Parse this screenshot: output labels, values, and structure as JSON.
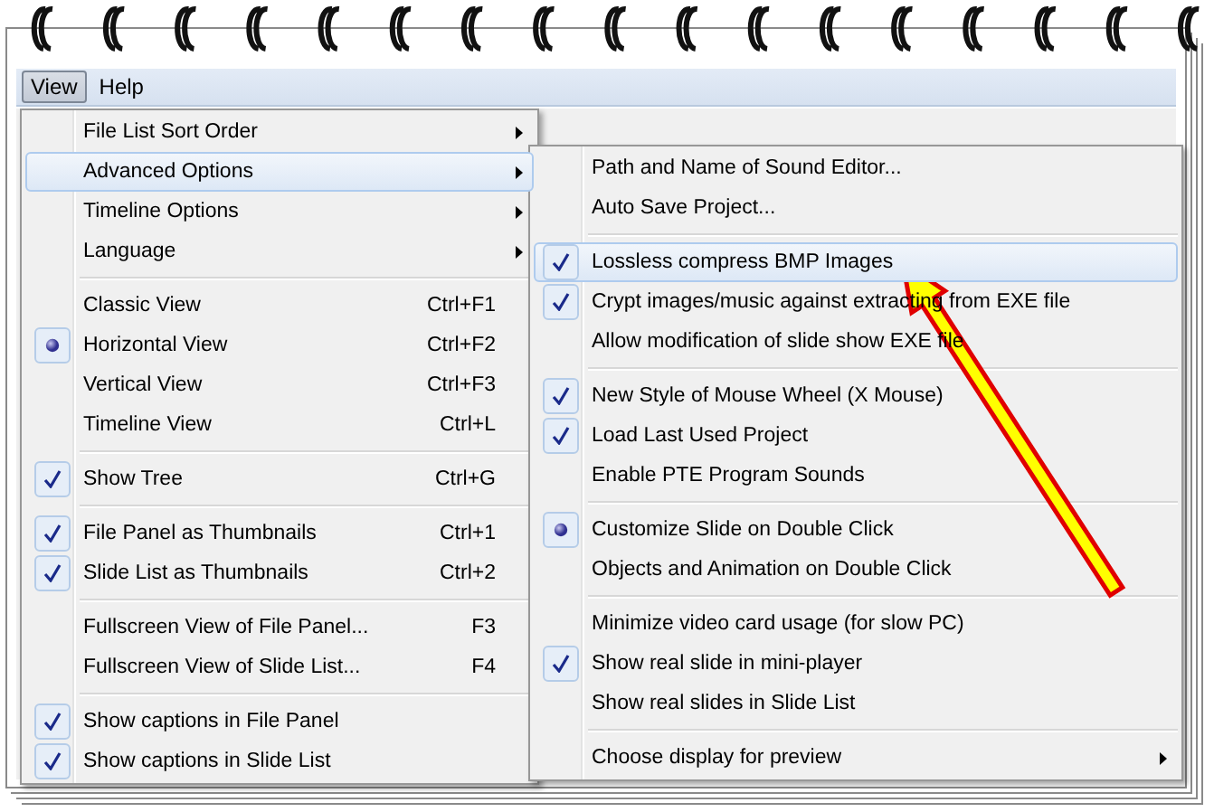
{
  "menubar": [
    {
      "label": "View",
      "selected": true
    },
    {
      "label": "Help",
      "selected": false
    }
  ],
  "view_menu": [
    {
      "kind": "item",
      "label": "File List Sort Order",
      "submenu": true,
      "checked": false,
      "selected": false
    },
    {
      "kind": "item",
      "label": "Advanced Options",
      "submenu": true,
      "checked": false,
      "selected": true
    },
    {
      "kind": "item",
      "label": "Timeline Options",
      "submenu": true,
      "checked": false,
      "selected": false
    },
    {
      "kind": "item",
      "label": "Language",
      "submenu": true,
      "checked": false,
      "selected": false
    },
    {
      "kind": "separator"
    },
    {
      "kind": "item",
      "label": "Classic View",
      "shortcut": "Ctrl+F1",
      "checked": false,
      "selected": false
    },
    {
      "kind": "item",
      "label": "Horizontal View",
      "shortcut": "Ctrl+F2",
      "checked": true,
      "radio": true,
      "selected": false
    },
    {
      "kind": "item",
      "label": "Vertical View",
      "shortcut": "Ctrl+F3",
      "checked": false,
      "selected": false
    },
    {
      "kind": "item",
      "label": "Timeline View",
      "shortcut": "Ctrl+L",
      "checked": false,
      "selected": false
    },
    {
      "kind": "separator"
    },
    {
      "kind": "item",
      "label": "Show Tree",
      "shortcut": "Ctrl+G",
      "checked": true,
      "selected": false
    },
    {
      "kind": "separator"
    },
    {
      "kind": "item",
      "label": "File Panel as Thumbnails",
      "shortcut": "Ctrl+1",
      "checked": true,
      "selected": false
    },
    {
      "kind": "item",
      "label": "Slide List as Thumbnails",
      "shortcut": "Ctrl+2",
      "checked": true,
      "selected": false
    },
    {
      "kind": "separator"
    },
    {
      "kind": "item",
      "label": "Fullscreen View of File Panel...",
      "shortcut": "F3",
      "checked": false,
      "selected": false
    },
    {
      "kind": "item",
      "label": "Fullscreen View of Slide List...",
      "shortcut": "F4",
      "checked": false,
      "selected": false
    },
    {
      "kind": "separator"
    },
    {
      "kind": "item",
      "label": "Show captions in File Panel",
      "checked": true,
      "selected": false
    },
    {
      "kind": "item",
      "label": "Show captions in Slide List",
      "checked": true,
      "selected": false
    }
  ],
  "advanced_options_menu": [
    {
      "kind": "item",
      "label": "Path and Name of Sound Editor...",
      "checked": false,
      "selected": false
    },
    {
      "kind": "item",
      "label": "Auto Save Project...",
      "checked": false,
      "selected": false
    },
    {
      "kind": "separator"
    },
    {
      "kind": "item",
      "label": "Lossless compress BMP Images",
      "checked": true,
      "selected": true
    },
    {
      "kind": "item",
      "label": "Crypt images/music against extracting from EXE file",
      "checked": true,
      "selected": false
    },
    {
      "kind": "item",
      "label": "Allow modification of slide show EXE file",
      "checked": false,
      "selected": false
    },
    {
      "kind": "separator"
    },
    {
      "kind": "item",
      "label": "New Style of Mouse Wheel (X Mouse)",
      "checked": true,
      "selected": false
    },
    {
      "kind": "item",
      "label": "Load Last Used Project",
      "checked": true,
      "selected": false
    },
    {
      "kind": "item",
      "label": "Enable PTE Program Sounds",
      "checked": false,
      "selected": false
    },
    {
      "kind": "separator"
    },
    {
      "kind": "item",
      "label": "Customize Slide on Double Click",
      "checked": true,
      "radio": true,
      "selected": false
    },
    {
      "kind": "item",
      "label": "Objects and Animation on Double Click",
      "checked": false,
      "selected": false
    },
    {
      "kind": "separator"
    },
    {
      "kind": "item",
      "label": "Minimize video card usage (for slow PC)",
      "checked": false,
      "selected": false
    },
    {
      "kind": "item",
      "label": "Show real slide in mini-player",
      "checked": true,
      "selected": false
    },
    {
      "kind": "item",
      "label": "Show real slides in Slide List",
      "checked": false,
      "selected": false
    },
    {
      "kind": "separator"
    },
    {
      "kind": "item",
      "label": "Choose display for preview",
      "submenu": true,
      "checked": false,
      "selected": false
    }
  ]
}
